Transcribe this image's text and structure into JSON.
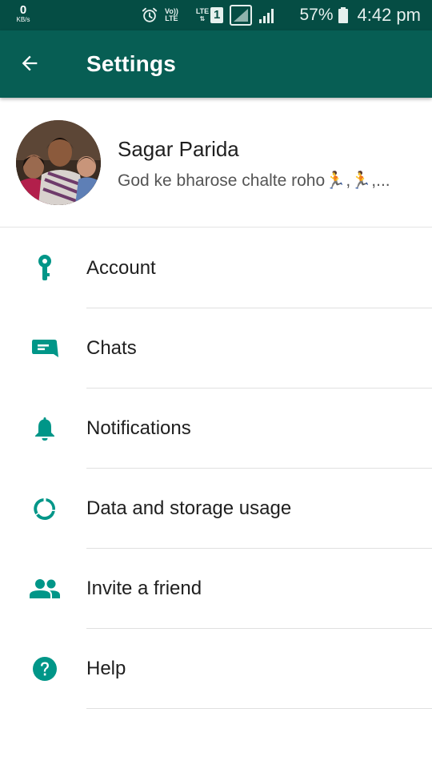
{
  "status_bar": {
    "speed_value": "0",
    "speed_unit": "KB/s",
    "volte_top": "Vo))",
    "volte_bottom": "LTE",
    "lte_label": "LTE",
    "sim_number": "1",
    "battery_percent": "57%",
    "time": "4:42 pm",
    "icons": [
      "alarm-icon",
      "volte-icon",
      "lte-icon",
      "no-signal-icon",
      "signal-icon",
      "battery-icon"
    ]
  },
  "app_bar": {
    "title": "Settings",
    "back_icon": "arrow-left-icon",
    "color": "#075e54"
  },
  "profile": {
    "name": "Sagar Parida",
    "status": "God ke bharose chalte roho🏃,🏃,..."
  },
  "settings": [
    {
      "label": "Account",
      "icon": "key-icon"
    },
    {
      "label": "Chats",
      "icon": "chat-icon"
    },
    {
      "label": "Notifications",
      "icon": "bell-icon"
    },
    {
      "label": "Data and storage usage",
      "icon": "data-usage-icon"
    },
    {
      "label": "Invite a friend",
      "icon": "people-icon"
    },
    {
      "label": "Help",
      "icon": "help-icon"
    }
  ],
  "colors": {
    "accent": "#009688",
    "status_bar": "#054d44",
    "app_bar": "#075e54"
  }
}
